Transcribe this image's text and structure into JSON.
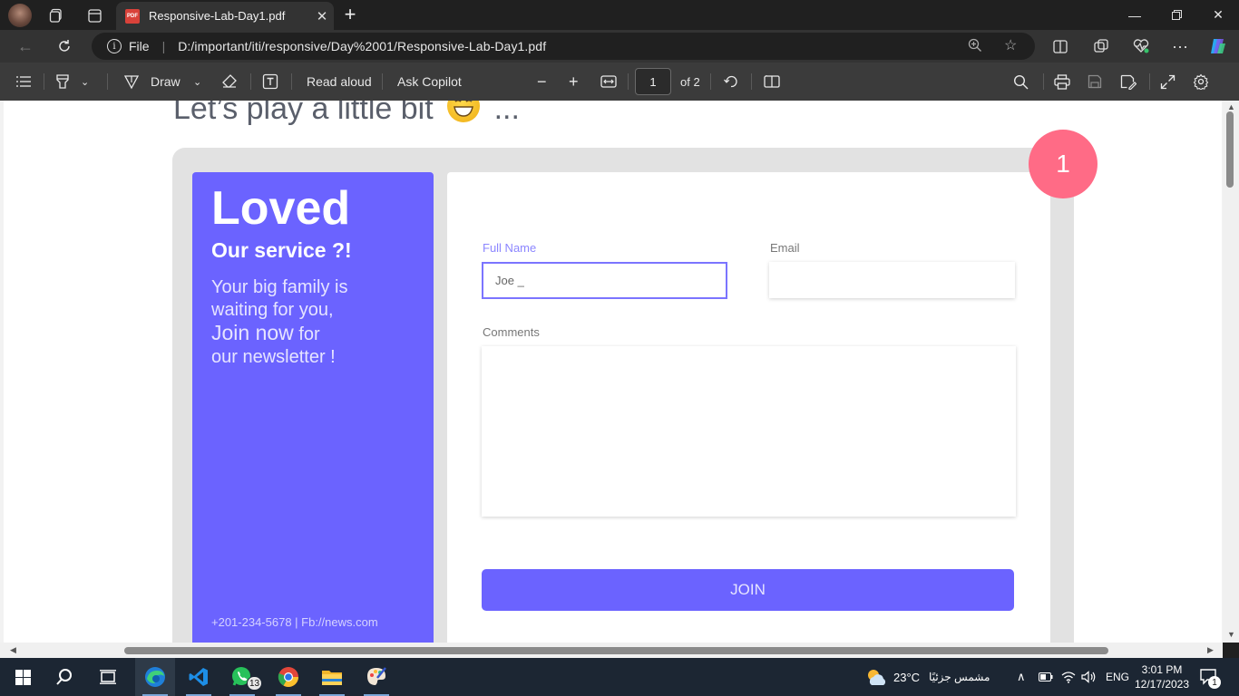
{
  "tab": {
    "title": "Responsive-Lab-Day1.pdf",
    "icon": "pdf-icon"
  },
  "address": {
    "scheme": "File",
    "url": "D:/important/iti/responsive/Day%2001/Responsive-Lab-Day1.pdf"
  },
  "pdf_toolbar": {
    "draw_label": "Draw",
    "read_aloud_label": "Read aloud",
    "ask_copilot_label": "Ask Copilot",
    "page_number": "1",
    "page_total": "of 2"
  },
  "document": {
    "heading": "Let’s play a little bit",
    "heading_suffix": "...",
    "badge_number": "1",
    "left_card": {
      "title": "Loved",
      "subtitle": "Our service ?!",
      "line1": "Your big family is",
      "line2": "waiting for you,",
      "line3_big": "Join now",
      "line3_small": " for",
      "line4": "our newsletter !",
      "contact": "+201-234-5678 | Fb://news.com"
    },
    "form": {
      "full_name_label": "Full Name",
      "full_name_value": "Joe _",
      "email_label": "Email",
      "email_value": "",
      "comments_label": "Comments",
      "comments_value": "",
      "join_label": "JOIN"
    }
  },
  "taskbar": {
    "whatsapp_badge": "13",
    "weather_temp": "23°C",
    "weather_text": "مشمس جزئيًا",
    "lang": "ENG",
    "time": "3:01 PM",
    "date": "12/17/2023",
    "notif_count": "1"
  },
  "colors": {
    "accent": "#6b63ff",
    "badge": "#ff6b86",
    "frame": "#e2e2e2"
  }
}
